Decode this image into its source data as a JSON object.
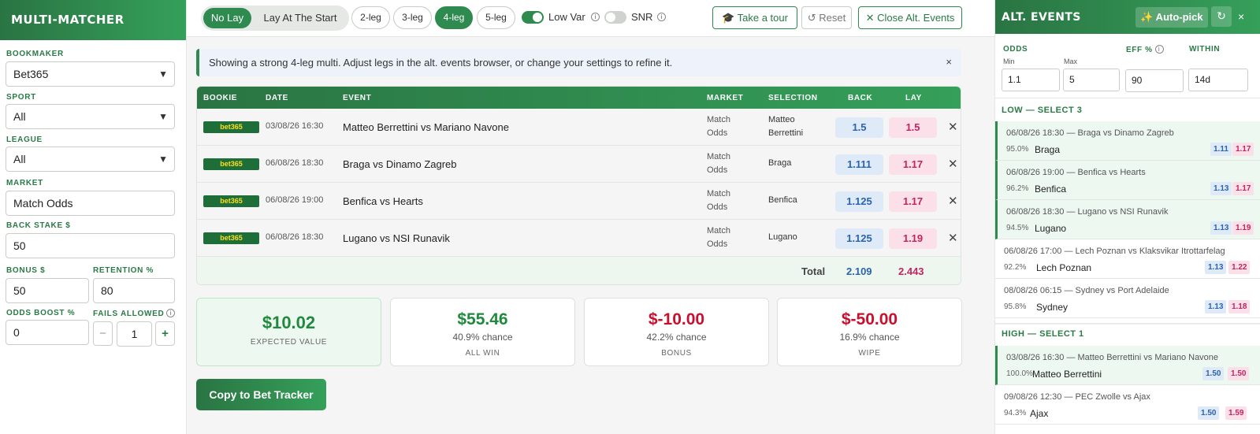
{
  "sidebar": {
    "title": "MULTI-MATCHER",
    "bookmaker": {
      "label": "BOOKMAKER",
      "value": "Bet365"
    },
    "sport": {
      "label": "SPORT",
      "value": "All"
    },
    "league": {
      "label": "LEAGUE",
      "value": "All"
    },
    "market": {
      "label": "MARKET",
      "value": "Match Odds"
    },
    "back_stake": {
      "label": "BACK STAKE $",
      "value": "50"
    },
    "bonus": {
      "label": "BONUS $",
      "value": "50"
    },
    "retention": {
      "label": "RETENTION %",
      "value": "80"
    },
    "odds_boost": {
      "label": "ODDS BOOST %",
      "value": "0"
    },
    "fails_allowed": {
      "label": "FAILS ALLOWED",
      "value": "1",
      "minus": "−",
      "plus": "+"
    }
  },
  "topbar": {
    "mode_options": [
      "No Lay",
      "Lay At The Start"
    ],
    "mode_selected": "No Lay",
    "leg_options": [
      "2-leg",
      "3-leg",
      "4-leg",
      "5-leg"
    ],
    "leg_selected": "4-leg",
    "low_var": {
      "label": "Low Var",
      "on": true
    },
    "snr": {
      "label": "SNR",
      "on": false
    },
    "tour_label": "Take a tour",
    "reset_label": "↺ Reset",
    "close_alt_label": "Close Alt. Events"
  },
  "banner": {
    "text": "Showing a strong 4-leg multi. Adjust legs in the alt. events browser, or change your settings to refine it.",
    "close": "×"
  },
  "table": {
    "headers": [
      "BOOKIE",
      "DATE",
      "EVENT",
      "MARKET",
      "SELECTION",
      "BACK",
      "LAY"
    ],
    "rows": [
      {
        "bookie": "bet365",
        "date": "03/08/26 16:30",
        "event": "Matteo Berrettini vs Mariano Navone",
        "market_1": "Match",
        "market_2": "Odds",
        "selection_1": "Matteo",
        "selection_2": "Berrettini",
        "back": "1.5",
        "lay": "1.5"
      },
      {
        "bookie": "bet365",
        "date": "06/08/26 18:30",
        "event": "Braga vs Dinamo Zagreb",
        "market_1": "Match",
        "market_2": "Odds",
        "selection_1": "Braga",
        "selection_2": "",
        "back": "1.111",
        "lay": "1.17"
      },
      {
        "bookie": "bet365",
        "date": "06/08/26 19:00",
        "event": "Benfica vs Hearts",
        "market_1": "Match",
        "market_2": "Odds",
        "selection_1": "Benfica",
        "selection_2": "",
        "back": "1.125",
        "lay": "1.17"
      },
      {
        "bookie": "bet365",
        "date": "06/08/26 18:30",
        "event": "Lugano vs NSI Runavik",
        "market_1": "Match",
        "market_2": "Odds",
        "selection_1": "Lugano",
        "selection_2": "",
        "back": "1.125",
        "lay": "1.19"
      }
    ],
    "total_label": "Total",
    "total_back": "2.109",
    "total_lay": "2.443"
  },
  "cards": [
    {
      "value": "$10.02",
      "chance": "",
      "label": "EXPECTED VALUE",
      "color": "#1f8a3e"
    },
    {
      "value": "$55.46",
      "chance": "40.9% chance",
      "label": "ALL WIN",
      "color": "#1f8a3e"
    },
    {
      "value": "$-10.00",
      "chance": "42.2% chance",
      "label": "BONUS",
      "color": "#c8102e"
    },
    {
      "value": "$-50.00",
      "chance": "16.9% chance",
      "label": "WIPE",
      "color": "#c8102e"
    }
  ],
  "copy_button": "Copy to Bet Tracker",
  "alt_panel": {
    "title": "ALT. EVENTS",
    "autopick_label": "✨ Auto-pick",
    "refresh_icon": "↻",
    "close_icon": "×",
    "odds_label": "ODDS",
    "min_label": "Min",
    "max_label": "Max",
    "min_value": "1.1",
    "max_value": "5",
    "eff_label": "EFF %",
    "eff_value": "90",
    "within_label": "WITHIN",
    "within_value": "14d",
    "low_group": "LOW — SELECT 3",
    "high_group": "HIGH — SELECT 1",
    "low_events": [
      {
        "line": "06/08/26 18:30 — Braga vs Dinamo Zagreb",
        "pct": "95.0%",
        "name": "Braga",
        "back": "1.11",
        "lay": "1.17",
        "selected": true
      },
      {
        "line": "06/08/26 19:00 — Benfica vs Hearts",
        "pct": "96.2%",
        "name": "Benfica",
        "back": "1.13",
        "lay": "1.17",
        "selected": true
      },
      {
        "line": "06/08/26 18:30 — Lugano vs NSI Runavik",
        "pct": "94.5%",
        "name": "Lugano",
        "back": "1.13",
        "lay": "1.19",
        "selected": true
      },
      {
        "line": "06/08/26 17:00 — Lech Poznan vs Klaksvikar Itrottarfelag",
        "pct": "92.2%",
        "name": "Lech Poznan",
        "back": "1.13",
        "lay": "1.22",
        "selected": false
      },
      {
        "line": "08/08/26 06:15 — Sydney vs Port Adelaide",
        "pct": "95.8%",
        "name": "Sydney",
        "back": "1.13",
        "lay": "1.18",
        "selected": false
      }
    ],
    "high_events": [
      {
        "line": "03/08/26 16:30 — Matteo Berrettini vs Mariano Navone",
        "pct": "100.0%",
        "name": "Matteo Berrettini",
        "back": "1.50",
        "lay": "1.50",
        "selected": true
      },
      {
        "line": "09/08/26 12:30 — PEC Zwolle vs Ajax",
        "pct": "94.3%",
        "name": "Ajax",
        "back": "1.50",
        "lay": "1.59",
        "selected": false
      }
    ]
  },
  "colors": {
    "brand": "#2e8a4e",
    "positive": "#1f8a3e",
    "negative": "#c8102e",
    "back": "#2b63ad",
    "lay": "#c0255e"
  }
}
